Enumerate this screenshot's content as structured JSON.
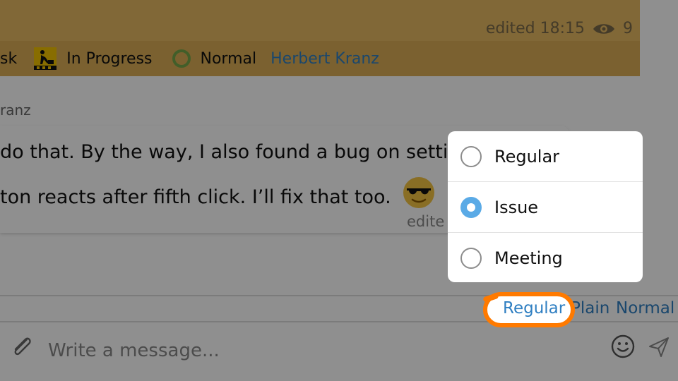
{
  "issue_card": {
    "edited_label": "edited 18:15",
    "views_icon": "eye-icon",
    "views_count": "9",
    "type_partial": "sk",
    "status_icon": "worker-icon",
    "status": "In Progress",
    "priority_icon": "ring-icon",
    "priority": "Normal",
    "author": "Herbert Kranz"
  },
  "reply": {
    "author_partial": "ranz",
    "line1": "do that. By the way, I also found a bug on settin",
    "line2": "ton reacts after fifth click. I’ll fix that too.",
    "emoji": "sunglasses-emoji",
    "edited_partial": "edite"
  },
  "format_bar": {
    "message_type": "Regular",
    "text_format": "Plain",
    "priority": "Normal"
  },
  "composer": {
    "placeholder": "Write a message...",
    "attach_icon": "paperclip-icon",
    "emoji_icon": "smiley-icon",
    "send_icon": "send-icon"
  },
  "type_menu": {
    "options": [
      {
        "label": "Regular",
        "selected": false
      },
      {
        "label": "Issue",
        "selected": true
      },
      {
        "label": "Meeting",
        "selected": false
      }
    ]
  },
  "colors": {
    "issue_card": "#e6b963",
    "link": "#2f7fc2",
    "radio_selected": "#5aaae6",
    "highlight": "#ff7a00"
  }
}
